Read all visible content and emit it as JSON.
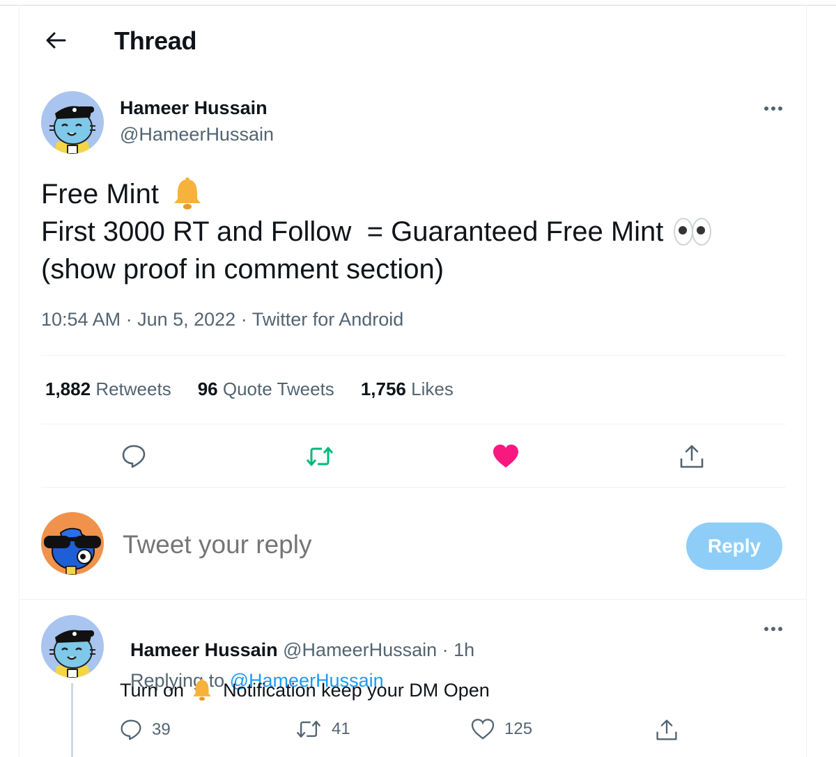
{
  "header": {
    "title": "Thread"
  },
  "tweet": {
    "author_name": "Hameer Hussain",
    "author_handle": "@HameerHussain",
    "lines": [
      "Free Mint",
      "First 3000 RT and Follow  = Guaranteed Free Mint",
      "(show proof in comment section)"
    ],
    "emojis": [
      "bell",
      "eyes"
    ],
    "timestamp": "10:54 AM · Jun 5, 2022 · Twitter for Android",
    "retweets_count": "1,882",
    "retweets_label": "Retweets",
    "quotes_count": "96",
    "quotes_label": "Quote Tweets",
    "likes_count": "1,756",
    "likes_label": "Likes",
    "liked": true
  },
  "composer": {
    "placeholder": "Tweet your reply",
    "reply_button": "Reply"
  },
  "reply": {
    "author_name": "Hameer Hussain",
    "author_handle": "@HameerHussain",
    "time": "· 1h",
    "replying_prefix": "Replying to",
    "replying_handle": "@HameerHussain",
    "text_before": "Turn on",
    "text_after": "Notification keep your DM Open",
    "reply_count": "39",
    "retweet_count": "41",
    "like_count": "125"
  },
  "colors": {
    "accent": "#1d9bf0",
    "like": "#f91880",
    "retweet": "#00ba7c",
    "reply_button_disabled": "#8ecdf8",
    "secondary_text": "#536471"
  }
}
